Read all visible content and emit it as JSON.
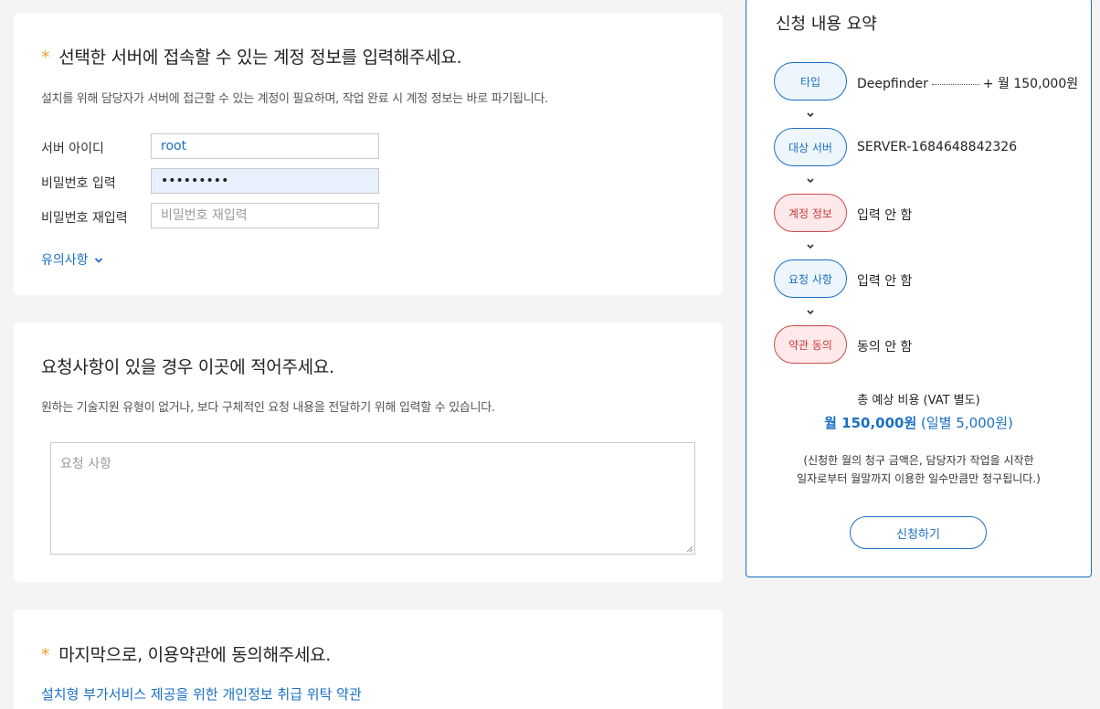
{
  "account_section": {
    "required_mark": "*",
    "title": "선택한 서버에 접속할 수 있는 계정 정보를 입력해주세요.",
    "description": "설치를 위해 담당자가 서버에 접근할 수 있는 계정이 필요하며, 작업 완료 시 계정 정보는 바로 파기됩니다.",
    "server_id_label": "서버 아이디",
    "server_id_value": "root",
    "password_label": "비밀번호 입력",
    "password_value": "passwordx",
    "password_confirm_label": "비밀번호 재입력",
    "password_confirm_placeholder": "비밀번호 재입력",
    "notice_link": "유의사항"
  },
  "request_section": {
    "title": "요청사항이 있을 경우 이곳에 적어주세요.",
    "description": "원하는 기술지원 유형이 없거나, 보다 구체적인 요청 내용을 전달하기 위해 입력할 수 있습니다.",
    "textarea_placeholder": "요청 사항"
  },
  "terms_section": {
    "required_mark": "*",
    "title": "마지막으로, 이용약관에 동의해주세요.",
    "terms_link": "설치형 부가서비스 제공을 위한 개인정보 취급 위탁 약관"
  },
  "summary": {
    "title": "신청 내용 요약",
    "steps": [
      {
        "label": "타입",
        "value": "Deepfinder",
        "price": "+ 월 150,000원",
        "status": "done"
      },
      {
        "label": "대상 서버",
        "value": "SERVER-1684648842326",
        "status": "done"
      },
      {
        "label": "계정 정보",
        "value": "입력 안 함",
        "status": "warn"
      },
      {
        "label": "요청 사항",
        "value": "입력 안 함",
        "status": "done"
      },
      {
        "label": "약관 동의",
        "value": "동의 안 함",
        "status": "warn"
      }
    ],
    "total_label": "총 예상 비용 (VAT 별도)",
    "total_monthly": "월 150,000원",
    "total_daily": "(일별 5,000원)",
    "billing_note_line1": "(신청한 월의 청구 금액은, 담당자가 작업을 시작한",
    "billing_note_line2": "일자로부터 월말까지 이용한 일수만큼만 청구됩니다.)",
    "apply_button": "신청하기"
  },
  "colors": {
    "accent": "#1a6fc4",
    "warning": "#d14a4a",
    "required_star": "#f0a030",
    "background": "#f4f4f4"
  }
}
